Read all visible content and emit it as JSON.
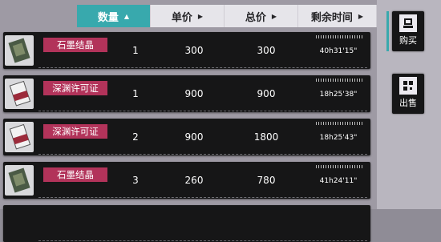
{
  "header": {
    "qty": "数量",
    "unit_price": "单价",
    "total_price": "总价",
    "remaining_time": "剩余时间"
  },
  "rows": [
    {
      "name": "石墨结晶",
      "icon": "graphite-crystal-icon",
      "qty": "1",
      "unit_price": "300",
      "total": "300",
      "time": "40h31'15\""
    },
    {
      "name": "深渊许可证",
      "icon": "abyss-permit-icon",
      "qty": "1",
      "unit_price": "900",
      "total": "900",
      "time": "18h25'38\""
    },
    {
      "name": "深渊许可证",
      "icon": "abyss-permit-icon",
      "qty": "2",
      "unit_price": "900",
      "total": "1800",
      "time": "18h25'43\""
    },
    {
      "name": "石墨结晶",
      "icon": "graphite-crystal-icon",
      "qty": "3",
      "unit_price": "260",
      "total": "780",
      "time": "41h24'11\""
    }
  ],
  "actions": {
    "buy": "购买",
    "sell": "出售"
  },
  "colors": {
    "accent_teal": "#38a9ad",
    "name_tag": "#b2335a",
    "row_bg": "#161617"
  }
}
